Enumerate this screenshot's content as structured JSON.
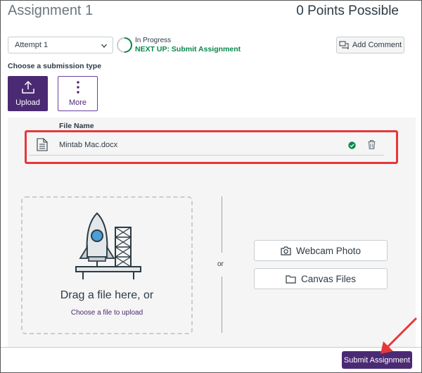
{
  "header": {
    "title": "Assignment 1",
    "points": "0 Points Possible"
  },
  "attempt": {
    "selected": "Attempt 1"
  },
  "status": {
    "label": "In Progress",
    "next": "NEXT UP: Submit Assignment"
  },
  "comment": {
    "label": "Add Comment"
  },
  "submission": {
    "heading": "Choose a submission type",
    "types": [
      {
        "label": "Upload",
        "icon": "upload-icon"
      },
      {
        "label": "More",
        "icon": "more-vertical-icon"
      }
    ]
  },
  "files": {
    "column_header": "File Name",
    "items": [
      {
        "name": "Mintab Mac.docx",
        "status_icon": "check-circle-icon"
      }
    ]
  },
  "dropzone": {
    "title": "Drag a file here, or",
    "link": "Choose a file to upload"
  },
  "alternatives": {
    "or": "or",
    "webcam": "Webcam Photo",
    "canvas_files": "Canvas Files"
  },
  "footer": {
    "submit": "Submit Assignment"
  },
  "colors": {
    "accent": "#4b2a74",
    "success": "#0b874b",
    "highlight": "#e5383b"
  }
}
